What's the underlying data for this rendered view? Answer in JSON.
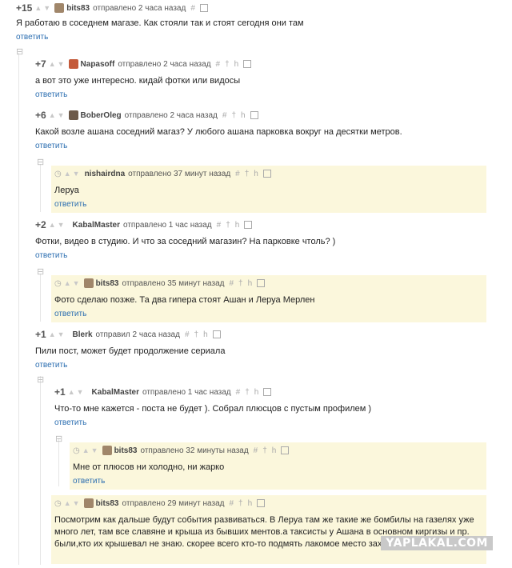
{
  "comments": [
    {
      "score": "+15",
      "author": "bits83",
      "time": "отправлено 2 часа назад",
      "text": "Я работаю в соседнем магазе. Как стояли так и стоят сегодня они там",
      "reply": "ответить"
    },
    {
      "score": "+7",
      "author": "Napasoff",
      "time": "отправлено 2 часа назад",
      "text": "а вот это уже интересно. кидай фотки или видосы",
      "reply": "ответить"
    },
    {
      "score": "+6",
      "author": "BoberOleg",
      "time": "отправлено 2 часа назад",
      "text": "Какой возле ашана соседний магаз? У любого ашана парковка вокруг на десятки метров.",
      "reply": "ответить"
    },
    {
      "score": "",
      "author": "nishairdna",
      "time": "отправлено 37 минут назад",
      "text": "Леруа",
      "reply": "ответить"
    },
    {
      "score": "+2",
      "author": "KabalMaster",
      "time": "отправлено 1 час назад",
      "text": "Фотки, видео в студию. И что за соседний магазин? На парковке чтоль? )",
      "reply": "ответить"
    },
    {
      "score": "",
      "author": "bits83",
      "time": "отправлено 35 минут назад",
      "text": "Фото сделаю позже. Та два гипера стоят Ашан и Леруа Мерлен",
      "reply": "ответить"
    },
    {
      "score": "+1",
      "author": "Blerk",
      "time": "отправил 2 часа назад",
      "text": "Пили пост, может будет продолжение сериала",
      "reply": "ответить"
    },
    {
      "score": "+1",
      "author": "KabalMaster",
      "time": "отправлено 1 час назад",
      "text": "Что-то мне кажется - поста не будет ). Собрал плюсцов с пустым профилем )",
      "reply": "ответить"
    },
    {
      "score": "",
      "author": "bits83",
      "time": "отправлено 32 минуты назад",
      "text": "Мне от плюсов ни холодно, ни жарко",
      "reply": "ответить"
    },
    {
      "score": "",
      "author": "bits83",
      "time": "отправлено 29 минут назад",
      "text": "Посмотрим как дальше будут события развиваться. В Леруа там же такие же бомбилы на газелях уже много лет, там все славяне и крыша из бывших ментов.а таксисты у Ашана в основном киргизы и пр. были,кто их крышевал не знаю. скорее всего кто-то подмять лакомое место захотел.",
      "reply": ""
    }
  ],
  "icons": {
    "vote_up": "▲",
    "vote_down": "▼",
    "link": "#",
    "plus": "†",
    "h": "h",
    "fold": "⊟"
  },
  "colors": {
    "highlight": "#fbf7dc",
    "link": "#2a6db0"
  },
  "watermark": "YAPLAKAL.COM"
}
